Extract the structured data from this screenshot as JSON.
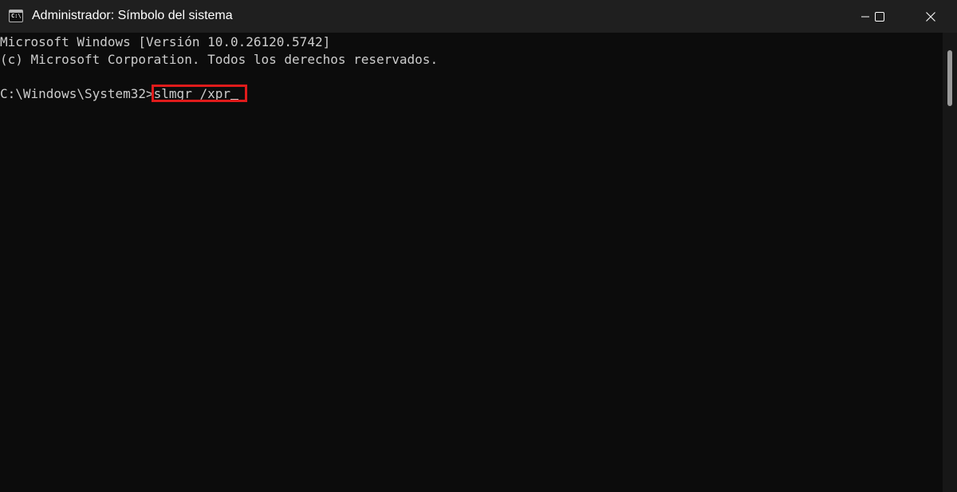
{
  "window": {
    "title": "Administrador: Símbolo del sistema",
    "icon": "command-prompt-icon",
    "controls": [
      "minimize-icon",
      "maximize-icon",
      "close-icon"
    ]
  },
  "console": {
    "line1": "Microsoft Windows [Versión 10.0.26120.5742]",
    "line2": "(c) Microsoft Corporation. Todos los derechos reservados.",
    "prompt": "C:\\Windows\\System32>",
    "command": "slmgr /xpr"
  },
  "colors": {
    "background": "#0c0c0c",
    "titlebar": "#1f1f1f",
    "text": "#cccccc",
    "highlight": "#e01b1b"
  }
}
